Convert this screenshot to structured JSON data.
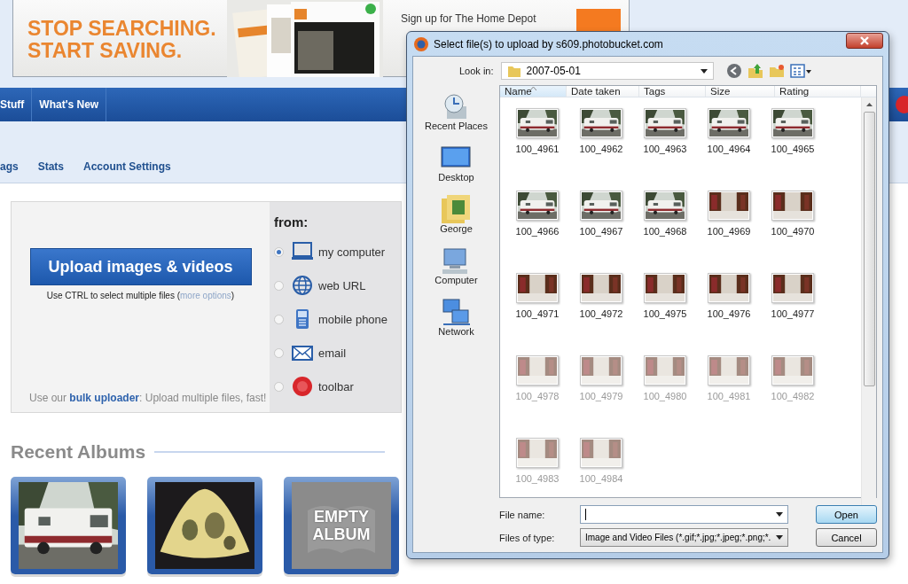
{
  "ad": {
    "headline": [
      "STOP SEARCHING.",
      "START SAVING."
    ],
    "signup": "Sign up for The Home Depot"
  },
  "nav": {
    "items": [
      {
        "label": "Stuff"
      },
      {
        "label": "What's New"
      }
    ]
  },
  "subnav": {
    "items": [
      "ags",
      "Stats",
      "Account Settings"
    ]
  },
  "upload": {
    "button": "Upload images & videos",
    "hint_before": "Use CTRL to select multiple files (",
    "hint_link": "more options",
    "hint_after": ")",
    "bulk_before": "Use our ",
    "bulk_link": "bulk uploader",
    "bulk_after": ": Upload multiple files, fast!",
    "from_label": "from:",
    "sources": [
      {
        "label": "my computer",
        "selected": true
      },
      {
        "label": "web URL",
        "selected": false
      },
      {
        "label": "mobile phone",
        "selected": false
      },
      {
        "label": "email",
        "selected": false
      },
      {
        "label": "toolbar",
        "selected": false
      }
    ]
  },
  "recent_albums": {
    "title": "Recent Albums",
    "albums": [
      {
        "kind": "picture"
      },
      {
        "kind": "picture"
      },
      {
        "kind": "empty",
        "label": "EMPTY ALBUM"
      }
    ]
  },
  "dialog": {
    "title": "Select file(s) to upload by s609.photobucket.com",
    "look_in_label": "Look in:",
    "folder": "2007-05-01",
    "places": [
      "Recent Places",
      "Desktop",
      "George",
      "Computer",
      "Network"
    ],
    "columns": [
      {
        "label": "Name",
        "sorted": true
      },
      {
        "label": "Date taken",
        "sorted": false
      },
      {
        "label": "Tags",
        "sorted": false
      },
      {
        "label": "Size",
        "sorted": false
      },
      {
        "label": "Rating",
        "sorted": false
      }
    ],
    "files": [
      {
        "name": "100_4961",
        "dimmed": false
      },
      {
        "name": "100_4962",
        "dimmed": false
      },
      {
        "name": "100_4963",
        "dimmed": false
      },
      {
        "name": "100_4964",
        "dimmed": false
      },
      {
        "name": "100_4965",
        "dimmed": false
      },
      {
        "name": "100_4966",
        "dimmed": false
      },
      {
        "name": "100_4967",
        "dimmed": false
      },
      {
        "name": "100_4968",
        "dimmed": false
      },
      {
        "name": "100_4969",
        "dimmed": false
      },
      {
        "name": "100_4970",
        "dimmed": false
      },
      {
        "name": "100_4971",
        "dimmed": false
      },
      {
        "name": "100_4972",
        "dimmed": false
      },
      {
        "name": "100_4975",
        "dimmed": false
      },
      {
        "name": "100_4976",
        "dimmed": false
      },
      {
        "name": "100_4977",
        "dimmed": false
      },
      {
        "name": "100_4978",
        "dimmed": true
      },
      {
        "name": "100_4979",
        "dimmed": true
      },
      {
        "name": "100_4980",
        "dimmed": true
      },
      {
        "name": "100_4981",
        "dimmed": true
      },
      {
        "name": "100_4982",
        "dimmed": true
      },
      {
        "name": "100_4983",
        "dimmed": true
      },
      {
        "name": "100_4984",
        "dimmed": true
      }
    ],
    "file_name_label": "File name:",
    "files_of_type_label": "Files of type:",
    "file_type": "Image and Video Files (*.gif;*.jpg;*.jpeg;*.png;*.",
    "buttons": [
      {
        "label": "Open",
        "default": true
      },
      {
        "label": "Cancel",
        "default": false
      }
    ]
  }
}
